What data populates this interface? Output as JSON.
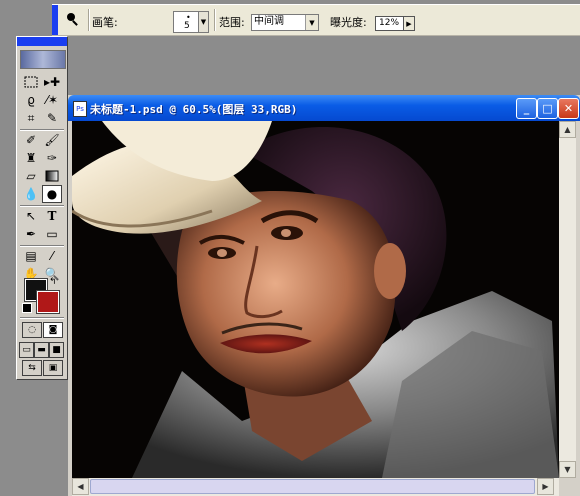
{
  "options_bar": {
    "tool_icon": "magnifier-burn-icon",
    "brush_label": "画笔:",
    "brush_size": "5",
    "range_label": "范围:",
    "range_value": "中间调",
    "exposure_label": "曝光度:",
    "exposure_value": "12%"
  },
  "toolbox": {
    "tools": [
      "rectangular-marquee-icon",
      "move-icon",
      "lasso-icon",
      "magic-wand-icon",
      "crop-icon",
      "slice-icon",
      "healing-brush-icon",
      "brush-icon",
      "clone-stamp-icon",
      "history-brush-icon",
      "eraser-icon",
      "gradient-icon",
      "blur-icon",
      "burn-icon",
      "path-selection-icon",
      "type-icon",
      "pen-icon",
      "rectangle-shape-icon",
      "notes-icon",
      "eyedropper-icon",
      "hand-icon",
      "zoom-icon"
    ],
    "foreground_color": "#111111",
    "background_color": "#b01818"
  },
  "document": {
    "title": "未标题-1.psd @ 60.5%(图层 33,RGB)"
  }
}
